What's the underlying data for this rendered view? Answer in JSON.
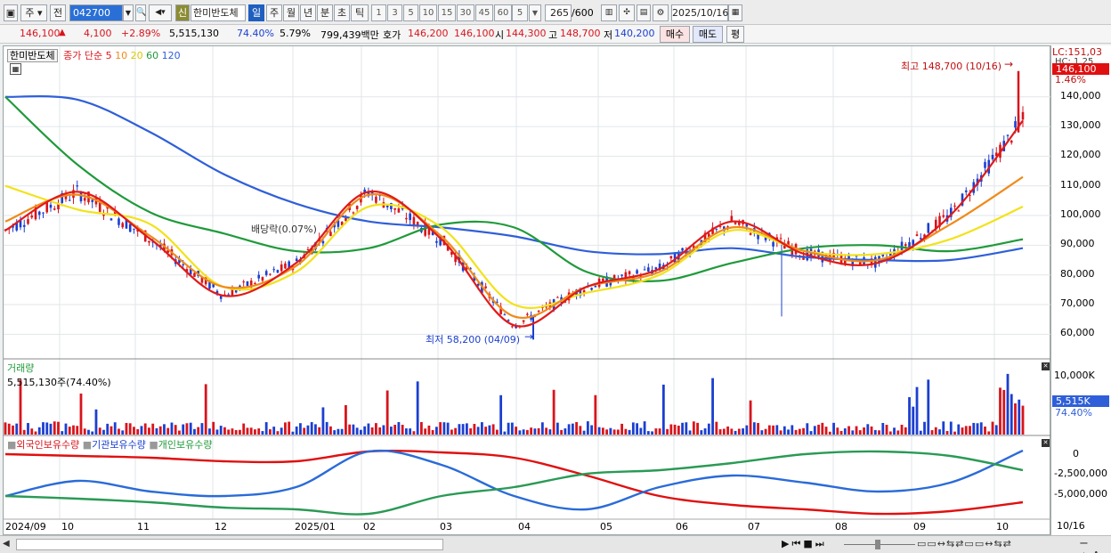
{
  "toolbar": {
    "market": "주",
    "prev": "전",
    "code": "042700",
    "new_badge": "신",
    "stock_name": "한미반도체",
    "periods": [
      "일",
      "주",
      "월",
      "년",
      "분",
      "초",
      "틱"
    ],
    "period_selected": "일",
    "minute_options": [
      "1",
      "3",
      "5",
      "10",
      "15",
      "30",
      "45",
      "60"
    ],
    "tick_select": "5",
    "count": "265",
    "count_max": "/600",
    "date": "2025/10/16"
  },
  "info": {
    "price": "146,100",
    "change_arrow": "▲",
    "change": "4,100",
    "change_pct": "+2.89%",
    "volume": "5,515,130",
    "volume_ratio": "74.40%",
    "turnover": "5.79%",
    "amount": "799,439백만",
    "quote_label": "호가",
    "ask": "146,200",
    "bid": "146,100",
    "open_label": "시",
    "open": "144,300",
    "high_label": "고",
    "high": "148,700",
    "low_label": "저",
    "low": "140,200",
    "buy_btn": "매수",
    "sell_btn": "매도",
    "eval_btn": "평"
  },
  "price_panel": {
    "stock_tag": "한미반도체",
    "legend_prefix": "종가 단순",
    "ma_periods": [
      "5",
      "10",
      "20",
      "60",
      "120"
    ],
    "dividend_label": "배당락(0.07%)",
    "high_note": "최고 148,700 (10/16)",
    "low_note": "최저 58,200 (04/09)",
    "lc_label": "LC:151,03",
    "hc_label": "HC: 1.25",
    "last_price_tag": "146,100",
    "last_pct_tag": "1.46%",
    "y_ticks": [
      "140,000",
      "130,000",
      "120,000",
      "110,000",
      "100,000",
      "90,000",
      "80,000",
      "70,000",
      "60,000"
    ]
  },
  "volume_panel": {
    "title": "거래량",
    "value_label": "5,515,130주(74.40%)",
    "y_tick": "10,000K",
    "last_tag": "5,515K",
    "last_pct": "74.40%"
  },
  "holdings_panel": {
    "legend": [
      "외국인보유수량",
      "기관보유수량",
      "개인보유수량"
    ],
    "y_ticks": [
      "0",
      "-2,500,000",
      "-5,000,000"
    ]
  },
  "x_axis": {
    "labels": [
      "2024/09",
      "10",
      "11",
      "12",
      "2025/01",
      "02",
      "03",
      "04",
      "05",
      "06",
      "07",
      "08",
      "09",
      "10"
    ],
    "end_label": "10/16"
  },
  "colors": {
    "up": "#d8141c",
    "down": "#1b3fd0",
    "ma5": "#e01a1a",
    "ma10": "#f08a1a",
    "ma20": "#f2e21a",
    "ma60": "#1f9a3a",
    "ma120": "#2f5fd8",
    "foreign": "#e01010",
    "institution": "#2a6bd8",
    "individual": "#2a9a55"
  },
  "chart_data": {
    "type": "line",
    "title": "한미반도체",
    "x": [
      "2024/09",
      "10",
      "11",
      "12",
      "2025/01",
      "02",
      "03",
      "04",
      "05",
      "06",
      "07",
      "08",
      "09",
      "10",
      "10/16"
    ],
    "series": [
      {
        "name": "5",
        "values": [
          95000,
          108000,
          92000,
          73000,
          84000,
          108000,
          92000,
          63000,
          76000,
          82000,
          98000,
          87000,
          84000,
          100000,
          132000
        ]
      },
      {
        "name": "10",
        "values": [
          98000,
          107000,
          93000,
          76000,
          83000,
          107000,
          93000,
          66000,
          76000,
          81000,
          96000,
          88000,
          85000,
          97000,
          113000
        ]
      },
      {
        "name": "20",
        "values": [
          110000,
          102000,
          97000,
          76000,
          81000,
          103000,
          96000,
          70000,
          74000,
          80000,
          95000,
          88000,
          87000,
          92000,
          103000
        ]
      },
      {
        "name": "60",
        "values": [
          140000,
          117000,
          101000,
          94000,
          88000,
          89000,
          97000,
          96000,
          81000,
          78000,
          84000,
          89000,
          90000,
          88000,
          92000
        ]
      },
      {
        "name": "120",
        "values": [
          140000,
          139000,
          128000,
          114000,
          104000,
          98000,
          96000,
          93000,
          88000,
          87000,
          89000,
          86000,
          85000,
          85000,
          89000
        ]
      }
    ],
    "high_point": {
      "label": "10/16",
      "value": 148700
    },
    "low_point": {
      "label": "04/09",
      "value": 58200
    },
    "ylim": [
      55000,
      151030
    ]
  }
}
